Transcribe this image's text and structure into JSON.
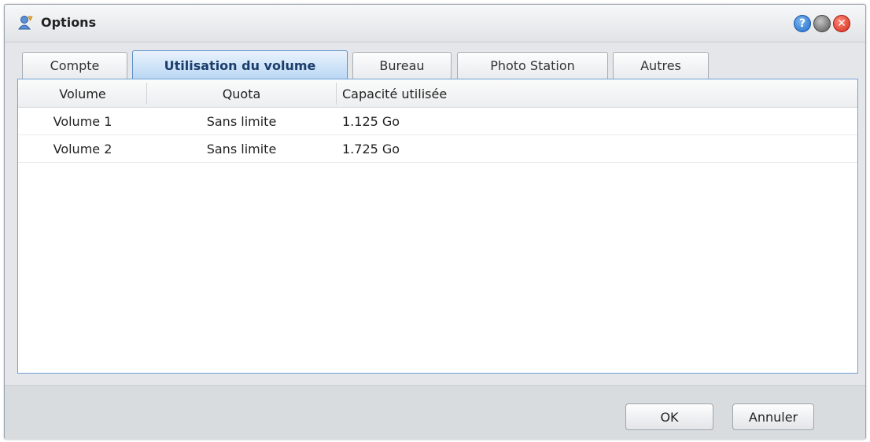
{
  "window": {
    "title": "Options",
    "controls": {
      "help": "?",
      "minimize": "",
      "close": "✕"
    }
  },
  "tabs": [
    {
      "label": "Compte",
      "active": false
    },
    {
      "label": "Utilisation du volume",
      "active": true
    },
    {
      "label": "Bureau",
      "active": false
    },
    {
      "label": "Photo Station",
      "active": false
    },
    {
      "label": "Autres",
      "active": false
    }
  ],
  "table": {
    "columns": [
      "Volume",
      "Quota",
      "Capacité utilisée"
    ],
    "rows": [
      [
        "Volume 1",
        "Sans limite",
        "1.125 Go"
      ],
      [
        "Volume 2",
        "Sans limite",
        "1.725 Go"
      ]
    ]
  },
  "footer": {
    "ok_label": "OK",
    "cancel_label": "Annuler"
  },
  "colors": {
    "active_tab_text": "#1b3d6b",
    "panel_border": "#6fa1d6",
    "close_button": "#d42a18",
    "help_button": "#1f6ac9"
  }
}
